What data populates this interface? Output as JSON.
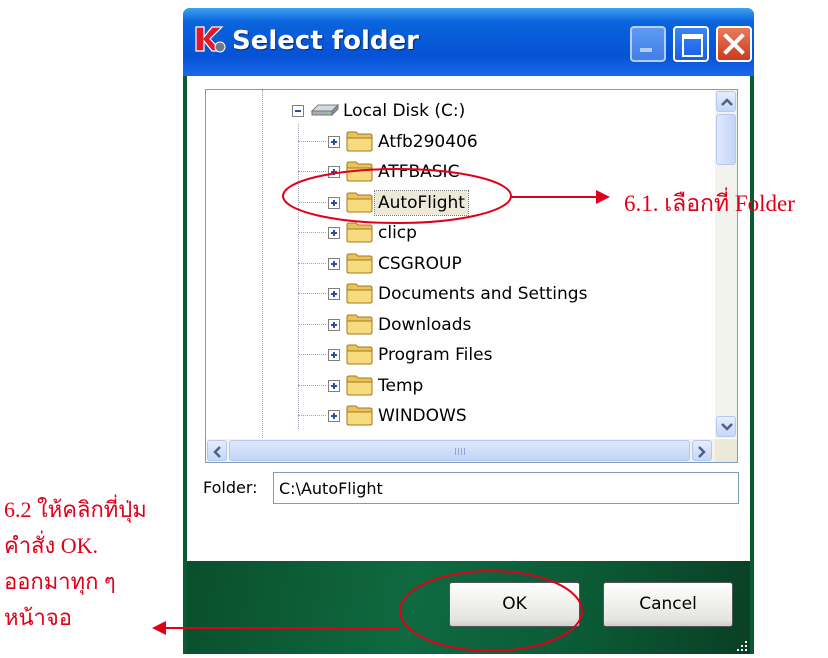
{
  "window": {
    "title": "Select folder"
  },
  "tree": {
    "root": {
      "label": "Local Disk (C:)",
      "icon": "hard-drive-icon",
      "expanded": true
    },
    "folders": [
      {
        "label": "Atfb290406"
      },
      {
        "label": "ATFBASIC"
      },
      {
        "label": "AutoFlight",
        "selected": true
      },
      {
        "label": "clicp"
      },
      {
        "label": "CSGROUP"
      },
      {
        "label": "Documents and Settings"
      },
      {
        "label": "Downloads"
      },
      {
        "label": "Program Files"
      },
      {
        "label": "Temp"
      },
      {
        "label": "WINDOWS"
      }
    ]
  },
  "folder_field": {
    "label": "Folder:",
    "value": "C:\\AutoFlight"
  },
  "buttons": {
    "ok": "OK",
    "cancel": "Cancel"
  },
  "annotations": {
    "step1": "6.1. เลือกที่ Folder",
    "step2_lines": [
      "6.2 ให้คลิกที่ปุ่ม",
      "คำสั่ง OK.",
      "ออกมาทุก ๆ",
      "หน้าจอ"
    ],
    "color": "#e0001b"
  },
  "colors": {
    "titlebar": "#0652d6",
    "footer": "#0a5a32",
    "selection": "#ece9d8"
  }
}
